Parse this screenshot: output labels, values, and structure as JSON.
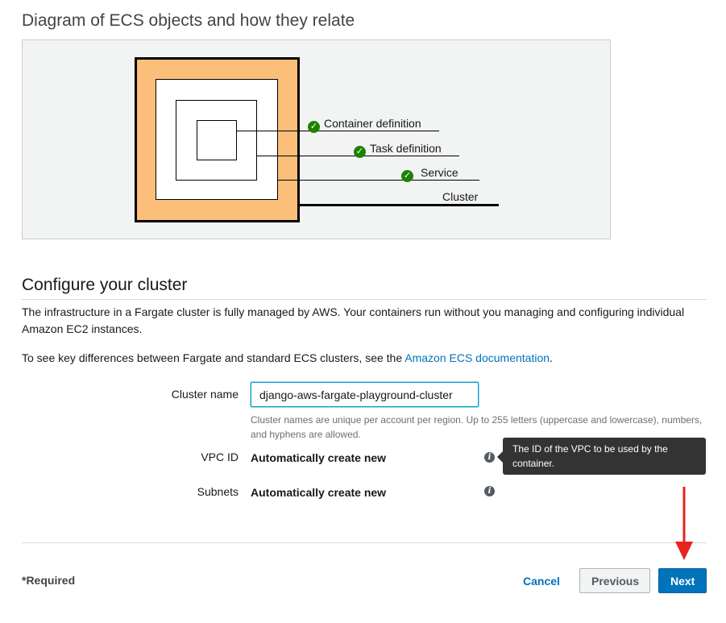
{
  "diagram": {
    "title": "Diagram of ECS objects and how they relate",
    "labels": {
      "container_definition": "Container definition",
      "task_definition": "Task definition",
      "service": "Service",
      "cluster": "Cluster"
    },
    "colors": {
      "cluster_fill": "#fbbf7a",
      "check_green": "#1d8102"
    }
  },
  "configure": {
    "title": "Configure your cluster",
    "intro": "The infrastructure in a Fargate cluster is fully managed by AWS. Your containers run without you managing and configuring individual Amazon EC2 instances.",
    "docs_prefix": "To see key differences between Fargate and standard ECS clusters, see the ",
    "docs_link": "Amazon ECS documentation",
    "docs_suffix": "."
  },
  "form": {
    "cluster_name_label": "Cluster name",
    "cluster_name_value": "django-aws-fargate-playground-cluster",
    "cluster_name_hint": "Cluster names are unique per account per region. Up to 255 letters (uppercase and lowercase), numbers, and hyphens are allowed.",
    "vpc_label": "VPC ID",
    "vpc_value": "Automatically create new",
    "subnets_label": "Subnets",
    "subnets_value": "Automatically create new",
    "tooltip": "The ID of the VPC to be used by the container."
  },
  "footer": {
    "required": "*Required",
    "cancel": "Cancel",
    "previous": "Previous",
    "next": "Next"
  },
  "colors": {
    "accent_blue": "#0073bb",
    "annotation_red": "#e8231f"
  }
}
